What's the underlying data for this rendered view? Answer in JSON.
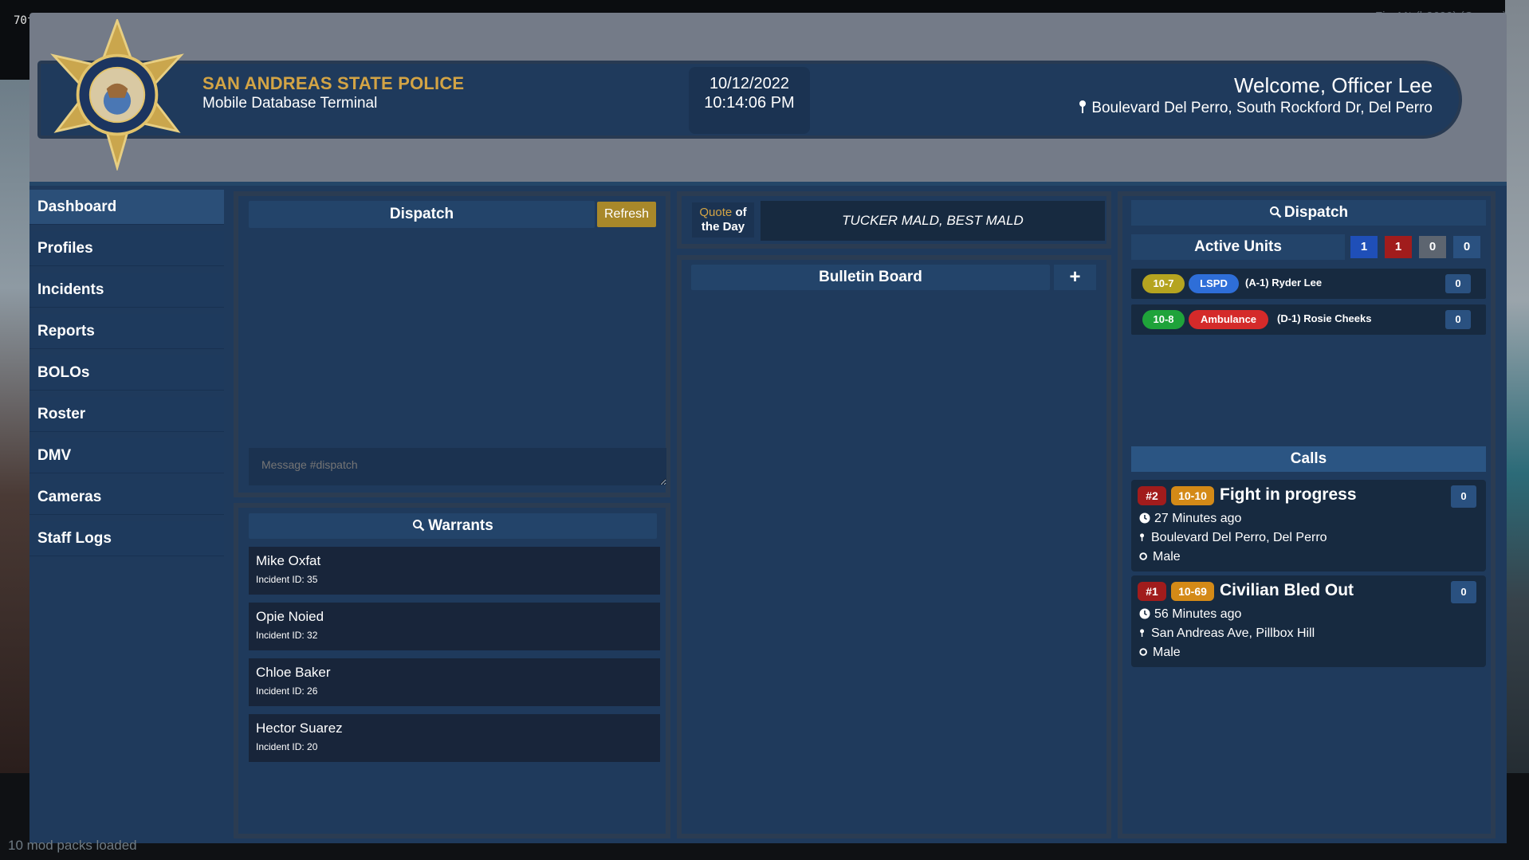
{
  "overlay": {
    "fps": "70fps",
    "client": "FiveM* (b2699) (Canary)",
    "mods": "10 mod packs loaded"
  },
  "header": {
    "agency": "SAN ANDREAS STATE POLICE",
    "subtitle": "Mobile Database Terminal",
    "date": "10/12/2022",
    "time": "10:14:06 PM",
    "welcome": "Welcome, Officer Lee",
    "location": "Boulevard Del Perro, South Rockford Dr, Del Perro"
  },
  "sidebar": {
    "items": [
      {
        "label": "Dashboard"
      },
      {
        "label": "Profiles"
      },
      {
        "label": "Incidents"
      },
      {
        "label": "Reports"
      },
      {
        "label": "BOLOs"
      },
      {
        "label": "Roster"
      },
      {
        "label": "DMV"
      },
      {
        "label": "Cameras"
      },
      {
        "label": "Staff Logs"
      }
    ]
  },
  "dispatch_chat": {
    "title": "Dispatch",
    "refresh_label": "Refresh",
    "placeholder": "Message #dispatch"
  },
  "warrants": {
    "title": "Warrants",
    "items": [
      {
        "name": "Mike Oxfat",
        "incident": "Incident ID: 35"
      },
      {
        "name": "Opie Noied",
        "incident": "Incident ID: 32"
      },
      {
        "name": "Chloe Baker",
        "incident": "Incident ID: 26"
      },
      {
        "name": "Hector Suarez",
        "incident": "Incident ID: 20"
      }
    ]
  },
  "quote": {
    "label_word1": "Quote",
    "label_word2": "of",
    "label_line2": "the Day",
    "text": "TUCKER MALD, BEST MALD"
  },
  "bulletin": {
    "title": "Bulletin Board",
    "add_label": "+"
  },
  "dispatch_units": {
    "title": "Dispatch",
    "active_label": "Active Units",
    "counts": [
      {
        "value": "1",
        "color": "#1f4fb8"
      },
      {
        "value": "1",
        "color": "#a11c1c"
      },
      {
        "value": "0",
        "color": "#5d6570"
      },
      {
        "value": "0",
        "color": "#2a5180"
      }
    ],
    "units": [
      {
        "status": "10-7",
        "status_color": "#b5a420",
        "dept": "LSPD",
        "dept_color": "#2e6ed8",
        "name": "(A-1) Ryder Lee",
        "count": "0"
      },
      {
        "status": "10-8",
        "status_color": "#1fa33a",
        "dept": "Ambulance",
        "dept_color": "#d42a2a",
        "name": "(D-1) Rosie Cheeks",
        "count": "0"
      }
    ]
  },
  "calls": {
    "title": "Calls",
    "items": [
      {
        "id": "#2",
        "code": "10-10",
        "title": "Fight in progress",
        "time": "27 Minutes ago",
        "location": "Boulevard Del Perro, Del Perro",
        "gender": "Male",
        "count": "0"
      },
      {
        "id": "#1",
        "code": "10-69",
        "title": "Civilian Bled Out",
        "time": "56 Minutes ago",
        "location": "San Andreas Ave, Pillbox Hill",
        "gender": "Male",
        "count": "0"
      }
    ]
  },
  "colors": {
    "accent_gold": "#d3a445",
    "panel_bg": "#1f3a5c",
    "frame_bg": "#747b88"
  }
}
